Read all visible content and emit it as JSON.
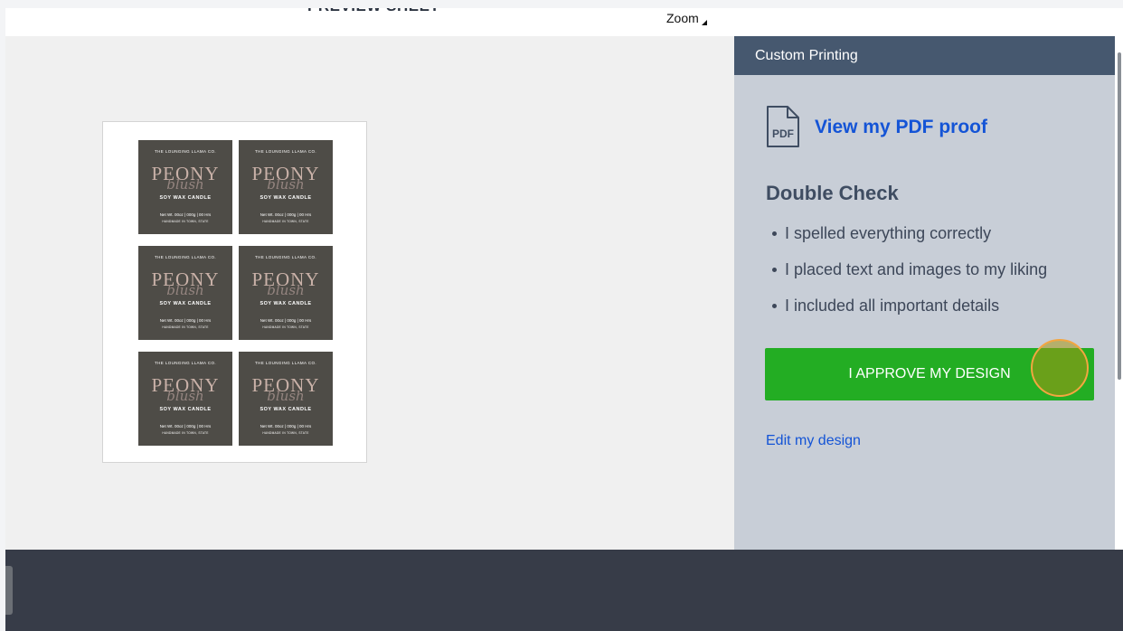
{
  "topbar": {
    "partial_title": "PREVIEW SHEET",
    "zoom_label": "Zoom"
  },
  "sheet": {
    "labels": [
      {
        "brand": "THE LOUNGING LLAMA CO.",
        "name": "PEONY",
        "script": "blush",
        "type": "SOY WAX CANDLE",
        "net": "Net Wt. 00oz | 000g | 00 Hrs",
        "made": "HANDMADE IN TOWN, STATE"
      },
      {
        "brand": "THE LOUNGING LLAMA CO.",
        "name": "PEONY",
        "script": "blush",
        "type": "SOY WAX CANDLE",
        "net": "Net Wt. 00oz | 000g | 00 Hrs",
        "made": "HANDMADE IN TOWN, STATE"
      },
      {
        "brand": "THE LOUNGING LLAMA CO.",
        "name": "PEONY",
        "script": "blush",
        "type": "SOY WAX CANDLE",
        "net": "Net Wt. 00oz | 000g | 00 Hrs",
        "made": "HANDMADE IN TOWN, STATE"
      },
      {
        "brand": "THE LOUNGING LLAMA CO.",
        "name": "PEONY",
        "script": "blush",
        "type": "SOY WAX CANDLE",
        "net": "Net Wt. 00oz | 000g | 00 Hrs",
        "made": "HANDMADE IN TOWN, STATE"
      },
      {
        "brand": "THE LOUNGING LLAMA CO.",
        "name": "PEONY",
        "script": "blush",
        "type": "SOY WAX CANDLE",
        "net": "Net Wt. 00oz | 000g | 00 Hrs",
        "made": "HANDMADE IN TOWN, STATE"
      },
      {
        "brand": "THE LOUNGING LLAMA CO.",
        "name": "PEONY",
        "script": "blush",
        "type": "SOY WAX CANDLE",
        "net": "Net Wt. 00oz | 000g | 00 Hrs",
        "made": "HANDMADE IN TOWN, STATE"
      }
    ]
  },
  "panel": {
    "header": "Custom Printing",
    "pdf_icon_text": "PDF",
    "proof_link": "View my PDF proof",
    "check_title": "Double Check",
    "checklist": [
      "I spelled everything correctly",
      "I placed text and images to my liking",
      "I included all important details"
    ],
    "approve_button": "I APPROVE MY DESIGN",
    "edit_link": "Edit my design"
  },
  "colors": {
    "panel_header": "#46586f",
    "panel_bg": "#c8ced7",
    "approve_green": "#23ad23",
    "link_blue": "#1454d6",
    "label_bg": "#4e4c47",
    "footer": "#373c48"
  }
}
